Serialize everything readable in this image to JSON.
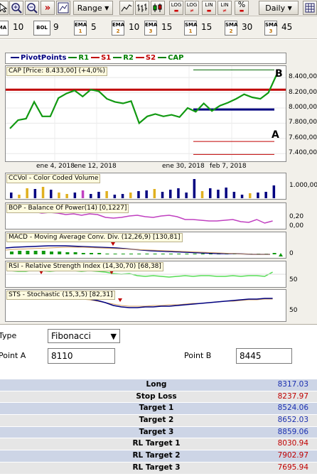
{
  "toolbar": {
    "range_label": "Range",
    "period_label": "Daily",
    "log1": "LOG",
    "log2": "LOG",
    "lin1": "LIN",
    "lin2": "LIN",
    "pct": "%"
  },
  "indicator_bar": [
    {
      "code": "MA",
      "sub": "",
      "value": "10"
    },
    {
      "code": "BOL",
      "sub": "",
      "value": "9"
    },
    {
      "code": "EMA",
      "sub": "1",
      "value": "5"
    },
    {
      "code": "EMA",
      "sub": "2",
      "value": "10"
    },
    {
      "code": "EMA",
      "sub": "3",
      "value": "15"
    },
    {
      "code": "SMA",
      "sub": "1",
      "value": "15"
    },
    {
      "code": "SMA",
      "sub": "2",
      "value": "30"
    },
    {
      "code": "SMA",
      "sub": "3",
      "value": "45"
    }
  ],
  "legend": {
    "items": [
      {
        "label": "PivotPoints",
        "color": "#000080"
      },
      {
        "label": "R1",
        "color": "#008000"
      },
      {
        "label": "S1",
        "color": "#c00000"
      },
      {
        "label": "R2",
        "color": "#008000"
      },
      {
        "label": "S2",
        "color": "#c00000"
      },
      {
        "label": "CAP",
        "color": "#008000"
      }
    ]
  },
  "price_panel": {
    "title": "CAP [Price: 8.433,00] (+4,0%)",
    "marker_a": "A",
    "marker_b": "B",
    "y_ticks": [
      "8.400,00",
      "8.200,00",
      "8.000,00",
      "7.800,00",
      "7.600,00",
      "7.400,00"
    ],
    "x_ticks": [
      "ene 4, 2018",
      "ene 12, 2018",
      "ene 30, 2018",
      "feb 7, 2018"
    ]
  },
  "chart_data": {
    "type": "line",
    "title": "CAP [Price: 8.433,00] (+4,0%)",
    "series": [
      {
        "name": "CAP",
        "values": [
          7730,
          7840,
          7860,
          8080,
          7890,
          7890,
          8130,
          8190,
          8230,
          8150,
          8240,
          8220,
          8120,
          8080,
          8060,
          8090,
          7800,
          7890,
          7920,
          7890,
          7910,
          7880,
          8000,
          7950,
          8060,
          7960,
          8030,
          8070,
          8120,
          8180,
          8140,
          8120,
          8200,
          8433
        ]
      },
      {
        "name": "R1",
        "values": [
          8240
        ]
      },
      {
        "name": "S1",
        "values": [
          7560
        ]
      },
      {
        "name": "R2",
        "values": [
          8500
        ]
      },
      {
        "name": "S2",
        "values": [
          7390
        ]
      },
      {
        "name": "PivotPoints",
        "values": [
          7980
        ]
      }
    ],
    "ylim": [
      7300,
      8550
    ]
  },
  "panels": {
    "ccvol": {
      "title": "CCVol - Color Coded Volume",
      "ticks": [
        "1.000,00"
      ]
    },
    "bop": {
      "title": "BOP - Balance Of Power(14) [0,1227]",
      "ticks": [
        "0,20",
        "0,00"
      ]
    },
    "macd": {
      "title": "MACD - Moving Average Conv. Div. (12,26,9) [130,81]",
      "ticks": [
        "0"
      ]
    },
    "rsi": {
      "title": "RSI - Relative Strength Index (14,30,70) [68,38]",
      "ticks": [
        "50"
      ]
    },
    "sts": {
      "title": "STS - Stochastic (15,3,5) [82,31]",
      "ticks": [
        "50"
      ]
    }
  },
  "form": {
    "type_label": "Type",
    "type_value": "Fibonacci",
    "point_a_label": "Point A",
    "point_a_value": "8110",
    "point_b_label": "Point B",
    "point_b_value": "8445"
  },
  "targets": [
    {
      "label": "Long",
      "value": "8317.03",
      "bg": "#cdd5e6",
      "color": "#1a2fb0"
    },
    {
      "label": "Stop Loss",
      "value": "8237.97",
      "bg": "#e6e6e6",
      "color": "#c00000"
    },
    {
      "label": "Target 1",
      "value": "8524.06",
      "bg": "#cdd5e6",
      "color": "#1a2fb0"
    },
    {
      "label": "Target 2",
      "value": "8652.03",
      "bg": "#e6e6e6",
      "color": "#1a2fb0"
    },
    {
      "label": "Target 3",
      "value": "8859.06",
      "bg": "#cdd5e6",
      "color": "#1a2fb0"
    },
    {
      "label": "RL Target 1",
      "value": "8030.94",
      "bg": "#e6e6e6",
      "color": "#c00000"
    },
    {
      "label": "RL Target 2",
      "value": "7902.97",
      "bg": "#cdd5e6",
      "color": "#c00000"
    },
    {
      "label": "RL Target 3",
      "value": "7695.94",
      "bg": "#e6e6e6",
      "color": "#c00000"
    }
  ]
}
